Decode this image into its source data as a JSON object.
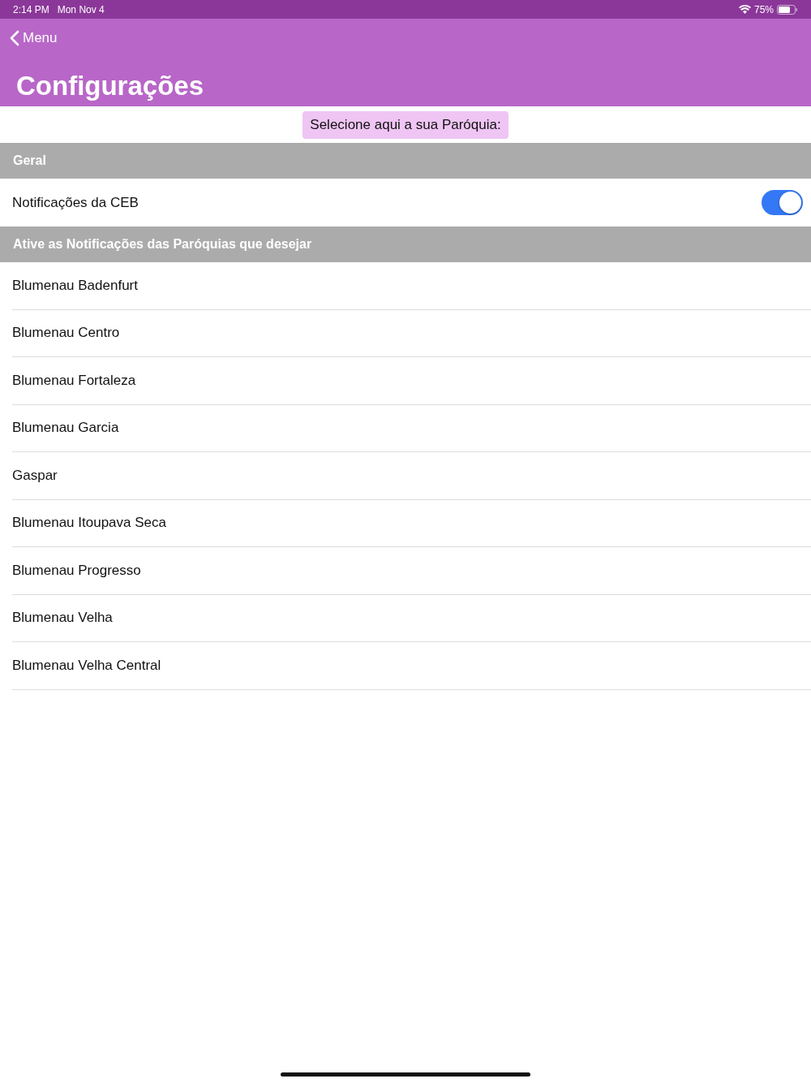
{
  "status_bar": {
    "time": "2:14 PM",
    "date": "Mon Nov 4",
    "battery": "75%"
  },
  "nav": {
    "back": "Menu",
    "title": "Configurações"
  },
  "parish_button": "Selecione aqui a sua Paróquia:",
  "sections": [
    {
      "header": "Geral",
      "rows": [
        {
          "kind": "toggle",
          "label": "Notificações da CEB",
          "on": true
        }
      ]
    },
    {
      "header": "Ative as Notificações das Paróquias que desejar",
      "rows": [
        {
          "kind": "plain",
          "label": "Blumenau Badenfurt"
        },
        {
          "kind": "plain",
          "label": "Blumenau Centro"
        },
        {
          "kind": "plain",
          "label": "Blumenau Fortaleza"
        },
        {
          "kind": "plain",
          "label": "Blumenau Garcia"
        },
        {
          "kind": "plain",
          "label": "Gaspar"
        },
        {
          "kind": "plain",
          "label": "Blumenau Itoupava Seca"
        },
        {
          "kind": "plain",
          "label": "Blumenau Progresso"
        },
        {
          "kind": "plain",
          "label": "Blumenau Velha"
        },
        {
          "kind": "plain",
          "label": "Blumenau Velha Central"
        }
      ]
    }
  ]
}
